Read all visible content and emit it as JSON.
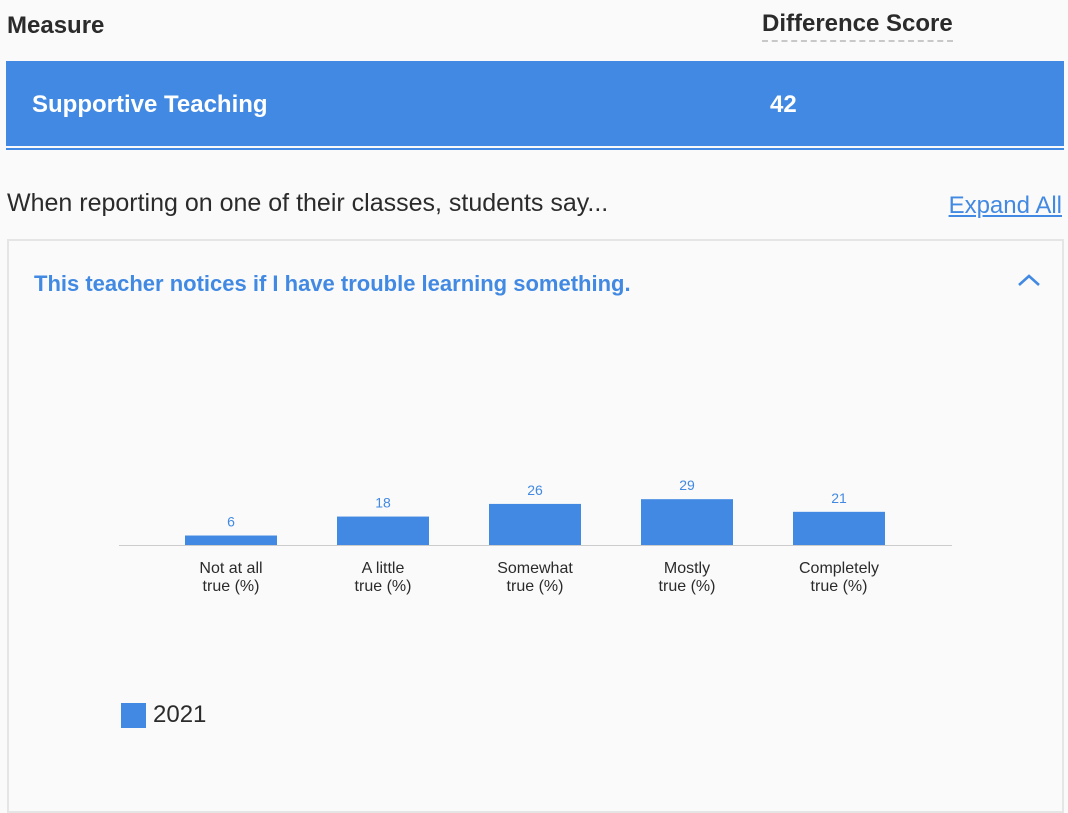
{
  "header": {
    "measure_label": "Measure",
    "difference_score_label": "Difference Score"
  },
  "measure_row": {
    "name": "Supportive Teaching",
    "score": "42"
  },
  "section": {
    "title": "When reporting on one of their classes, students say...",
    "expand_all_label": "Expand All"
  },
  "panel": {
    "question": "This teacher notices if I have trouble learning something.",
    "toggle_icon": "chevron-up-icon",
    "expanded": true
  },
  "colors": {
    "accent": "#4189e2",
    "text": "#2b2b2b",
    "axis": "#cccccc",
    "background": "#fafafa"
  },
  "chart_data": {
    "type": "bar",
    "title": "",
    "xlabel": "",
    "ylabel": "",
    "categories": [
      [
        "Not at all",
        "true (%)"
      ],
      [
        "A little",
        "true (%)"
      ],
      [
        "Somewhat",
        "true (%)"
      ],
      [
        "Mostly",
        "true (%)"
      ],
      [
        "Completely",
        "true (%)"
      ]
    ],
    "series": [
      {
        "name": "2021",
        "color": "#4189e2",
        "values": [
          6,
          18,
          26,
          29,
          21
        ]
      }
    ],
    "ylim": [
      0,
      100
    ],
    "grid": false,
    "data_labels": true,
    "legend_position": "bottom-left"
  }
}
